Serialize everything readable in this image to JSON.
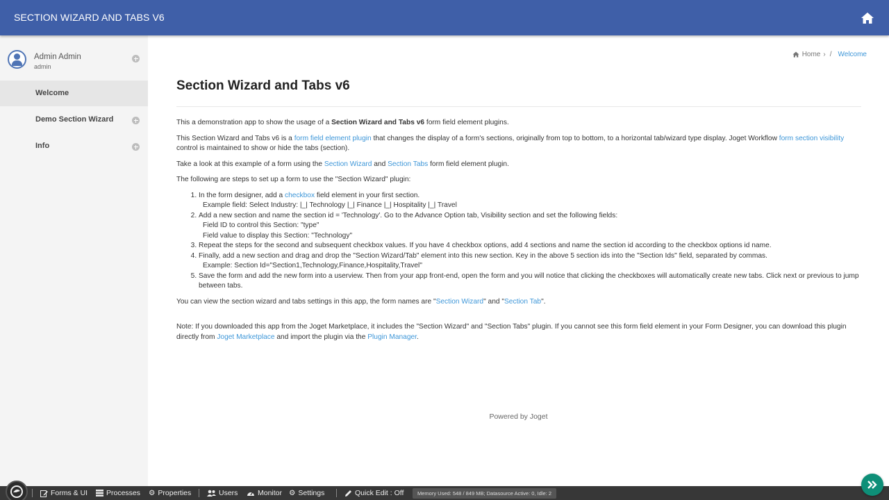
{
  "header": {
    "app_title": "SECTION WIZARD AND TABS V6",
    "home_icon": "home-icon"
  },
  "sidebar": {
    "profile": {
      "name": "Admin Admin",
      "login": "admin"
    },
    "items": [
      {
        "label": "Welcome",
        "active": true,
        "expandable": false
      },
      {
        "label": "Demo Section Wizard",
        "active": false,
        "expandable": true
      },
      {
        "label": "Info",
        "active": false,
        "expandable": true
      }
    ]
  },
  "breadcrumb": {
    "home": "Home",
    "sep1": "›",
    "sep2": "/",
    "current": "Welcome"
  },
  "page": {
    "title": "Section Wizard and Tabs v6",
    "p1": {
      "a": "This a demonstration app to show the usage of a ",
      "b": "Section Wizard and Tabs v6",
      "c": " form field element plugins."
    },
    "p2": {
      "a": "This Section Wizard and Tabs v6 is a ",
      "link1": "form field element plugin",
      "b": " that changes the display of a form's sections, originally from top to bottom, to a horizontal tab/wizard type display. Joget Workflow ",
      "link2": "form section visibility",
      "c": " control is maintained to show or hide the tabs (section)."
    },
    "p3": {
      "a": "Take a look at this example of a form using the ",
      "link1": "Section Wizard",
      "b": " and ",
      "link2": "Section Tabs",
      "c": " form field element plugin."
    },
    "p4": "The following are steps to set up a form to use the \"Section Wizard\" plugin:",
    "steps": {
      "s1a": "In the form designer, add a ",
      "s1link": "checkbox",
      "s1b": " field element in your first section.",
      "s1sub": "Example field: Select Industry: |_| Technology |_| Finance |_| Hospitality |_| Travel",
      "s2": "Add a new section and name the section id = 'Technology'. Go to the Advance Option tab, Visibility section and set the following fields:",
      "s2sub1": "Field ID to control this Section: \"type\"",
      "s2sub2": "Field value to display this Section: \"Technology\"",
      "s3": "Repeat the steps for the second and subsequent checkbox values. If you have 4 checkbox options, add 4 sections and name the section id according to the checkbox options id name.",
      "s4": "Finally, add a new section and drag and drop the \"Section Wizard/Tab\" element into this new section. Key in the above 5 section ids into the \"Section Ids\" field, separated by commas.",
      "s4sub": "Example: Section Id=\"Section1,Technology,Finance,Hospitality,Travel\"",
      "s5": "Save the form and add the new form into a userview. Then from your app front-end, open the form and you will notice that clicking the checkboxes will automatically create new tabs. Click next or previous to jump between tabs."
    },
    "p5": {
      "a": "You can view the section wizard and tabs settings in this app, the form names are \"",
      "link1": "Section Wizard",
      "b": "\" and \"",
      "link2": "Section Tab",
      "c": "\"."
    },
    "note": {
      "a": "Note: If you downloaded this app from the Joget Marketplace, it includes the \"Section Wizard\" and \"Section Tabs\" plugin. If you cannot see this form field element in your Form Designer, you can download this plugin directly from ",
      "link1": "Joget Marketplace",
      "b": " and import the plugin via the ",
      "link2": "Plugin Manager",
      "c": "."
    }
  },
  "footer": {
    "powered": "Powered by Joget"
  },
  "bottombar": {
    "forms": "Forms & UI",
    "processes": "Processes",
    "properties": "Properties",
    "users": "Users",
    "monitor": "Monitor",
    "settings": "Settings",
    "quick_edit": "Quick Edit : Off",
    "memory": "Memory Used: 548 / 849 MB; Datasource Active: 0, Idle: 2"
  },
  "colors": {
    "header": "#3f5fa8",
    "link": "#3d96d8",
    "fab": "#0e8f78",
    "bottombar": "#373737"
  }
}
